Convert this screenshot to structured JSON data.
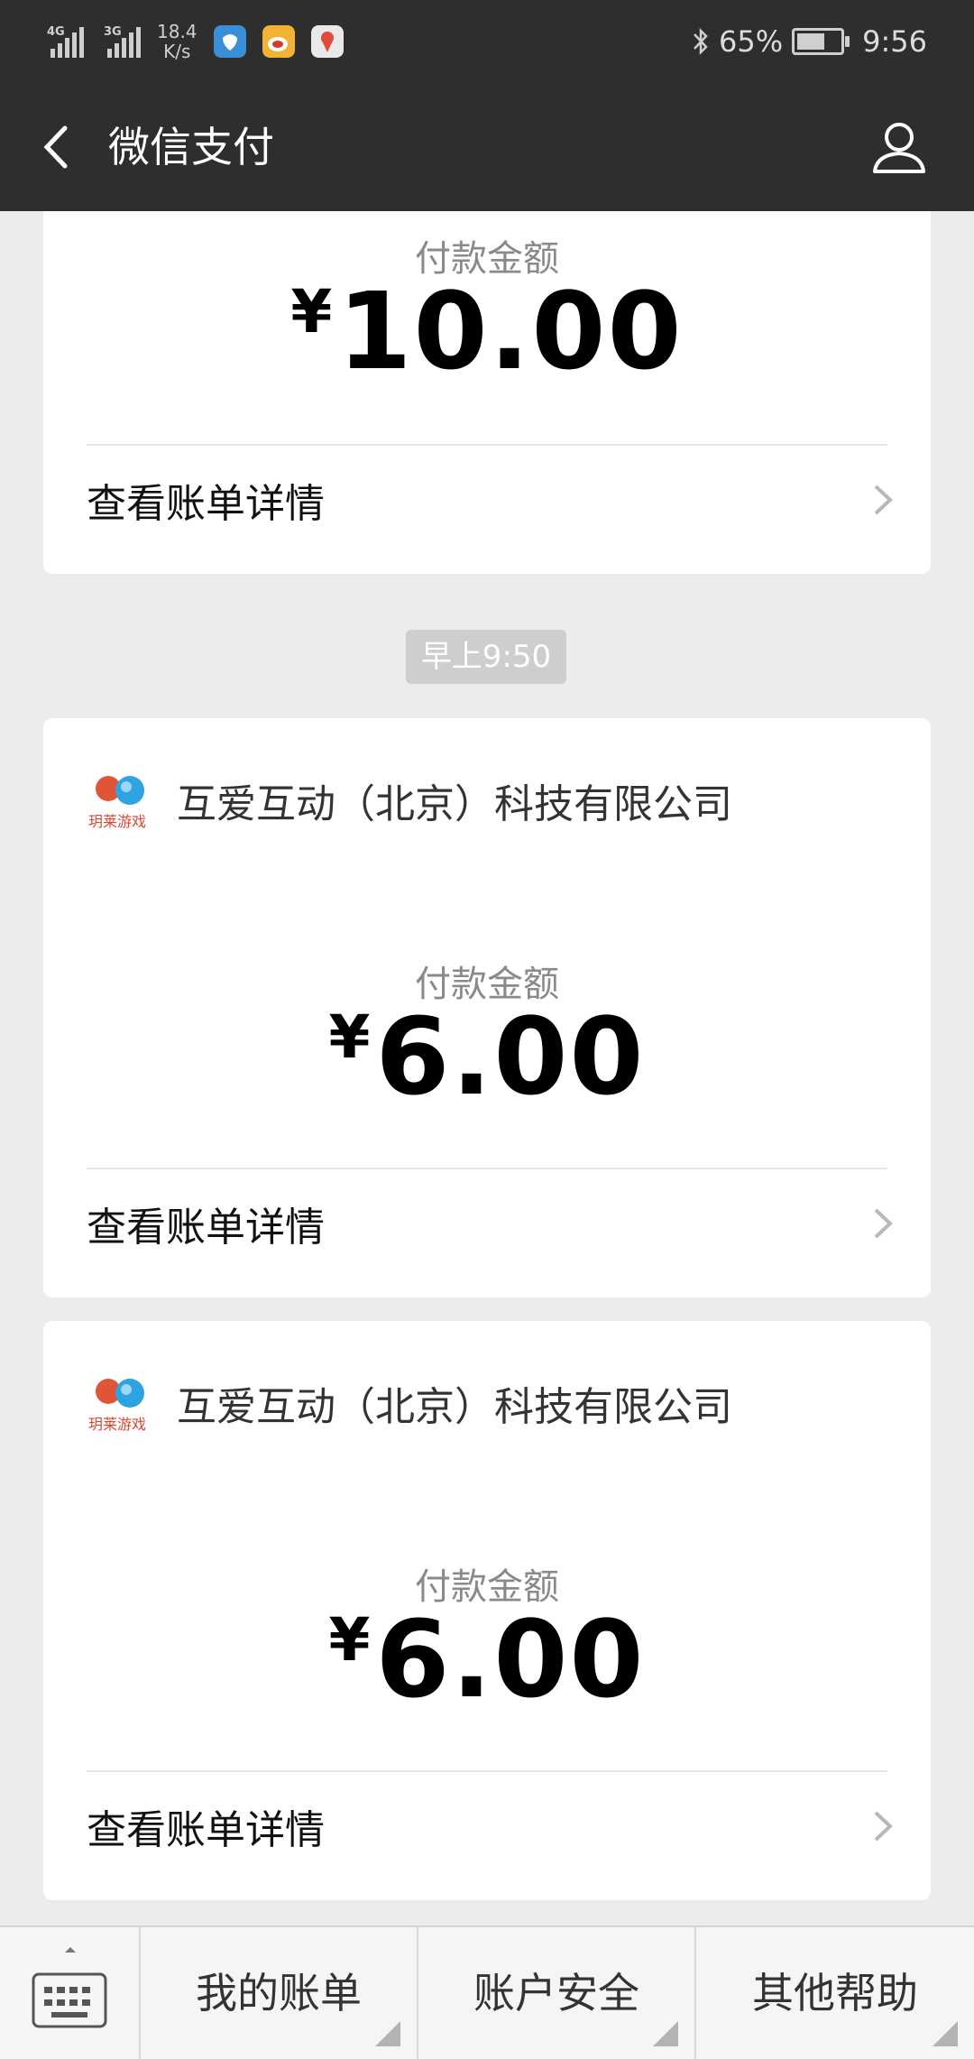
{
  "status_bar": {
    "signal1_tag": "4G",
    "signal2_tag": "3G",
    "speed_value": "18.4",
    "speed_unit": "K/s",
    "battery": "65%",
    "battery_level": 0.65,
    "time": "9:56"
  },
  "nav": {
    "title": "微信支付",
    "back_icon": "chevron-left-icon",
    "user_icon": "person-icon"
  },
  "cards": [
    {
      "amount_label": "付款金额",
      "currency": "¥",
      "amount": "10.00",
      "detail_label": "查看账单详情"
    },
    {
      "merchant": "互爱互动（北京）科技有限公司",
      "logo_text": "玥莱游戏",
      "amount_label": "付款金额",
      "currency": "¥",
      "amount": "6.00",
      "detail_label": "查看账单详情"
    },
    {
      "merchant": "互爱互动（北京）科技有限公司",
      "logo_text": "玥莱游戏",
      "amount_label": "付款金额",
      "currency": "¥",
      "amount": "6.00",
      "detail_label": "查看账单详情"
    }
  ],
  "time_separator": "早上9:50",
  "bottom_menu": {
    "item1": "我的账单",
    "item2": "账户安全",
    "item3": "其他帮助",
    "keyboard_icon": "keyboard-icon"
  },
  "colors": {
    "header": "#2e2e2e",
    "background": "#ececec",
    "card": "#ffffff"
  }
}
